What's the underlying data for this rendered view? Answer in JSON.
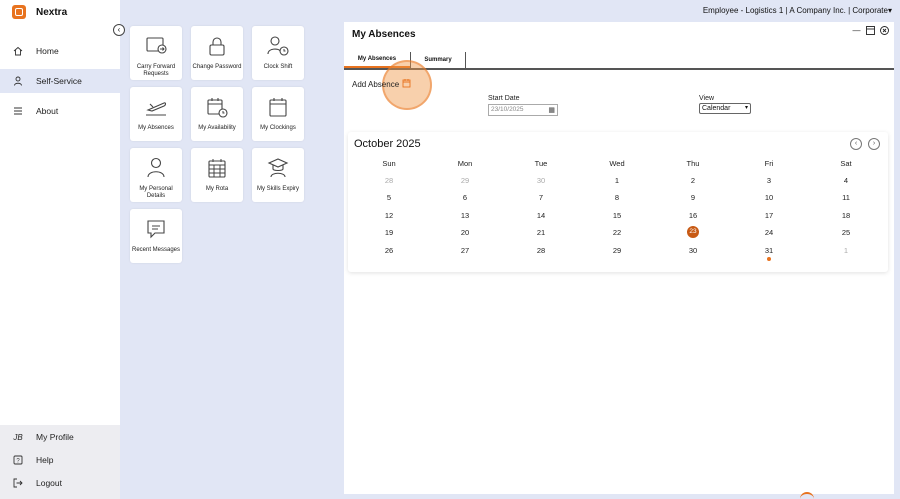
{
  "brand": {
    "name": "Nextra"
  },
  "topbar": {
    "context": "Employee - Logistics 1 | A Company Inc. | Corporate",
    "caret": "▾"
  },
  "sidebar": {
    "items": [
      {
        "label": "Home",
        "icon": "home-icon"
      },
      {
        "label": "Self-Service",
        "icon": "user-icon"
      },
      {
        "label": "About",
        "icon": "menu-icon"
      }
    ],
    "bottom": [
      {
        "label": "My Profile",
        "icon": "initials",
        "initials": "JB"
      },
      {
        "label": "Help",
        "icon": "help-icon"
      },
      {
        "label": "Logout",
        "icon": "logout-icon"
      }
    ]
  },
  "tiles": [
    {
      "label": "Carry Forward Requests",
      "icon": "carry-forward-icon"
    },
    {
      "label": "Change Password",
      "icon": "lock-icon"
    },
    {
      "label": "Clock Shift",
      "icon": "clock-user-icon"
    },
    {
      "label": "My Absences",
      "icon": "plane-icon"
    },
    {
      "label": "My Availability",
      "icon": "calendar-clock-icon"
    },
    {
      "label": "My Clockings",
      "icon": "calendar-icon"
    },
    {
      "label": "My Personal Details",
      "icon": "person-icon"
    },
    {
      "label": "My Rota",
      "icon": "grid-calendar-icon"
    },
    {
      "label": "My Skills Expiry",
      "icon": "graduate-icon"
    },
    {
      "label": "Recent Messages",
      "icon": "message-icon"
    }
  ],
  "panel": {
    "title": "My Absences",
    "tabs": [
      "My Absences",
      "Summary"
    ],
    "add_absence": "Add Absence",
    "start_date_label": "Start Date",
    "start_date_value": "23/10/2025",
    "view_label": "View",
    "view_value": "Calendar"
  },
  "calendar": {
    "month": "October 2025",
    "weekdays": [
      "Sun",
      "Mon",
      "Tue",
      "Wed",
      "Thu",
      "Fri",
      "Sat"
    ],
    "weeks": [
      [
        "28",
        "29",
        "30",
        "1",
        "2",
        "3",
        "4"
      ],
      [
        "5",
        "6",
        "7",
        "8",
        "9",
        "10",
        "11"
      ],
      [
        "12",
        "13",
        "14",
        "15",
        "16",
        "17",
        "18"
      ],
      [
        "19",
        "20",
        "21",
        "22",
        "23",
        "24",
        "25"
      ],
      [
        "26",
        "27",
        "28",
        "29",
        "30",
        "31",
        "1"
      ]
    ],
    "muted": [
      [
        0,
        0
      ],
      [
        0,
        1
      ],
      [
        0,
        2
      ],
      [
        4,
        6
      ]
    ],
    "today": [
      3,
      4
    ],
    "dot": [
      4,
      5
    ]
  },
  "colors": {
    "accent": "#e8731f",
    "sidebar_active": "#e1e6f5"
  }
}
